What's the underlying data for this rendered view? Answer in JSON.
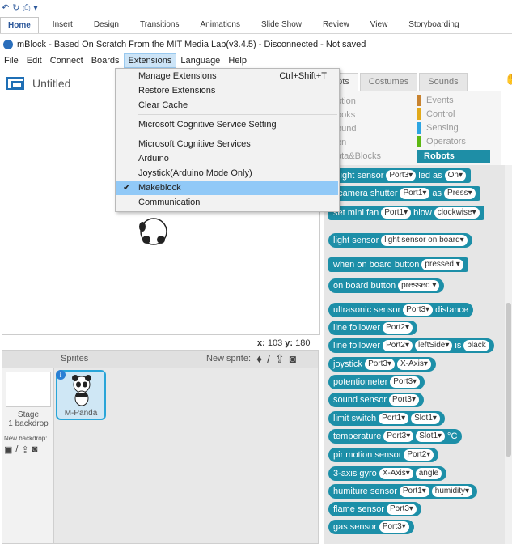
{
  "ribbon": {
    "tabs": [
      "Home",
      "Insert",
      "Design",
      "Transitions",
      "Animations",
      "Slide Show",
      "Review",
      "View",
      "Storyboarding"
    ]
  },
  "window": {
    "title": "mBlock - Based On Scratch From the MIT Media Lab(v3.4.5) - Disconnected - Not saved"
  },
  "menubar": [
    "File",
    "Edit",
    "Connect",
    "Boards",
    "Extensions",
    "Language",
    "Help"
  ],
  "stage": {
    "project_title": "Untitled",
    "x_label": "x:",
    "x_value": "103",
    "y_label": "y:",
    "y_value": "180"
  },
  "sprites_panel": {
    "label": "Sprites",
    "new_sprite_label": "New sprite:",
    "stage_name": "Stage",
    "stage_backdrops": "1 backdrop",
    "new_backdrop_label": "New backdrop:",
    "sprite_name": "M-Panda"
  },
  "script_tabs": [
    "ripts",
    "Costumes",
    "Sounds"
  ],
  "categories": [
    {
      "label": "otion"
    },
    {
      "label": "ooks"
    },
    {
      "label": "ound"
    },
    {
      "label": "en"
    },
    {
      "label": "ata&Blocks"
    },
    {
      "label": "Events",
      "color": "#c88330"
    },
    {
      "label": "Control",
      "color": "#e1a91a"
    },
    {
      "label": "Sensing",
      "color": "#2ca5e2"
    },
    {
      "label": "Operators",
      "color": "#5cb712"
    },
    {
      "label": "Robots",
      "color": "#1e8ea6"
    }
  ],
  "extensions_menu": {
    "items": [
      {
        "label": "Manage Extensions",
        "shortcut": "Ctrl+Shift+T"
      },
      {
        "label": "Restore Extensions"
      },
      {
        "label": "Clear Cache"
      },
      {
        "label": "Microsoft Cognitive Service Setting"
      },
      {
        "label": "Microsoft Cognitive Services"
      },
      {
        "label": "Arduino"
      },
      {
        "label": "Joystick(Arduino Mode Only)"
      },
      {
        "label": "Makeblock",
        "checked": true
      },
      {
        "label": "Communication"
      }
    ]
  },
  "blocks": [
    {
      "parts": [
        "t light sensor",
        "Port3▾",
        "led as",
        "On▾"
      ]
    },
    {
      "parts": [
        "t camera shutter",
        "Port1▾",
        "as",
        "Press▾"
      ]
    },
    {
      "parts": [
        "set mini fan",
        "Port1▾",
        "blow",
        "clockwise▾"
      ]
    },
    {
      "parts": [
        "light sensor",
        "light sensor on board▾"
      ]
    },
    {
      "parts": [
        "when on board button",
        "pressed ▾"
      ]
    },
    {
      "parts": [
        "on board button",
        "pressed ▾"
      ]
    },
    {
      "parts": [
        "ultrasonic sensor",
        "Port3▾",
        "distance"
      ]
    },
    {
      "parts": [
        "line follower",
        "Port2▾"
      ]
    },
    {
      "parts": [
        "line follower",
        "Port2▾",
        "leftSide▾",
        "is",
        "black"
      ]
    },
    {
      "parts": [
        "joystick",
        "Port3▾",
        "X-Axis▾"
      ]
    },
    {
      "parts": [
        "potentiometer",
        "Port3▾"
      ]
    },
    {
      "parts": [
        "sound sensor",
        "Port3▾"
      ]
    },
    {
      "parts": [
        "limit switch",
        "Port1▾",
        "Slot1▾"
      ]
    },
    {
      "parts": [
        "temperature",
        "Port3▾",
        "Slot1▾",
        "°C"
      ]
    },
    {
      "parts": [
        "pir motion sensor",
        "Port2▾"
      ]
    },
    {
      "parts": [
        "3-axis gyro",
        "X-Axis▾",
        "angle"
      ]
    },
    {
      "parts": [
        "humiture sensor",
        "Port1▾",
        "humidity▾"
      ]
    },
    {
      "parts": [
        "flame sensor",
        "Port3▾"
      ]
    },
    {
      "parts": [
        "gas sensor",
        "Port3▾"
      ]
    }
  ]
}
